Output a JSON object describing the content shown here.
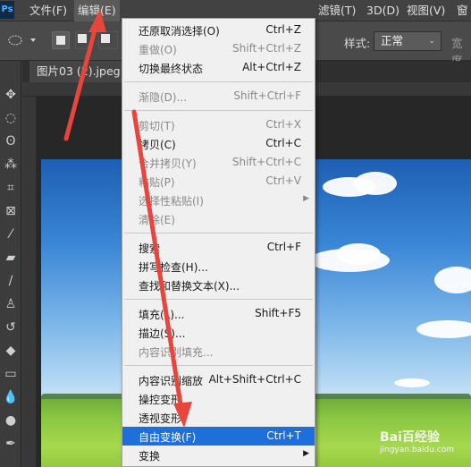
{
  "app": {
    "logo": "Ps"
  },
  "menubar": {
    "items": [
      "文件(F)",
      "编辑(E)",
      "滤镜(T)",
      "3D(D)",
      "视图(V)",
      "窗"
    ]
  },
  "options": {
    "style_label": "样式:",
    "style_value": "正常",
    "width_label": "宽度"
  },
  "document": {
    "tab_title": "图片03 (2).jpeg @"
  },
  "edit_menu": {
    "groups": [
      [
        {
          "label": "还原取消选择(O)",
          "shortcut": "Ctrl+Z",
          "enabled": true
        },
        {
          "label": "重做(O)",
          "shortcut": "Shift+Ctrl+Z",
          "enabled": false
        },
        {
          "label": "切换最终状态",
          "shortcut": "Alt+Ctrl+Z",
          "enabled": true
        }
      ],
      [
        {
          "label": "渐隐(D)...",
          "shortcut": "Shift+Ctrl+F",
          "enabled": false
        }
      ],
      [
        {
          "label": "剪切(T)",
          "shortcut": "Ctrl+X",
          "enabled": false
        },
        {
          "label": "拷贝(C)",
          "shortcut": "Ctrl+C",
          "enabled": true
        },
        {
          "label": "合并拷贝(Y)",
          "shortcut": "Shift+Ctrl+C",
          "enabled": false
        },
        {
          "label": "粘贴(P)",
          "shortcut": "Ctrl+V",
          "enabled": false
        },
        {
          "label": "选择性粘贴(I)",
          "shortcut": "",
          "enabled": false,
          "submenu": true
        },
        {
          "label": "清除(E)",
          "shortcut": "",
          "enabled": false
        }
      ],
      [
        {
          "label": "搜索",
          "shortcut": "Ctrl+F",
          "enabled": true
        },
        {
          "label": "拼写检查(H)...",
          "shortcut": "",
          "enabled": true
        },
        {
          "label": "查找和替换文本(X)...",
          "shortcut": "",
          "enabled": true
        }
      ],
      [
        {
          "label": "填充(L)...",
          "shortcut": "Shift+F5",
          "enabled": true
        },
        {
          "label": "描边(S)...",
          "shortcut": "",
          "enabled": true
        },
        {
          "label": "内容识别填充...",
          "shortcut": "",
          "enabled": false
        }
      ],
      [
        {
          "label": "内容识别缩放",
          "shortcut": "Alt+Shift+Ctrl+C",
          "enabled": true
        },
        {
          "label": "操控变形",
          "shortcut": "",
          "enabled": true
        },
        {
          "label": "透视变形",
          "shortcut": "",
          "enabled": true
        },
        {
          "label": "自由变换(F)",
          "shortcut": "Ctrl+T",
          "enabled": true,
          "highlighted": true
        },
        {
          "label": "变换",
          "shortcut": "",
          "enabled": true,
          "submenu": true
        }
      ]
    ]
  },
  "watermark": {
    "text": "Bai百经验",
    "sub": "jingyan.baidu.com"
  },
  "colors": {
    "highlight": "#1e6fd9",
    "annotation": "#e8453c"
  }
}
